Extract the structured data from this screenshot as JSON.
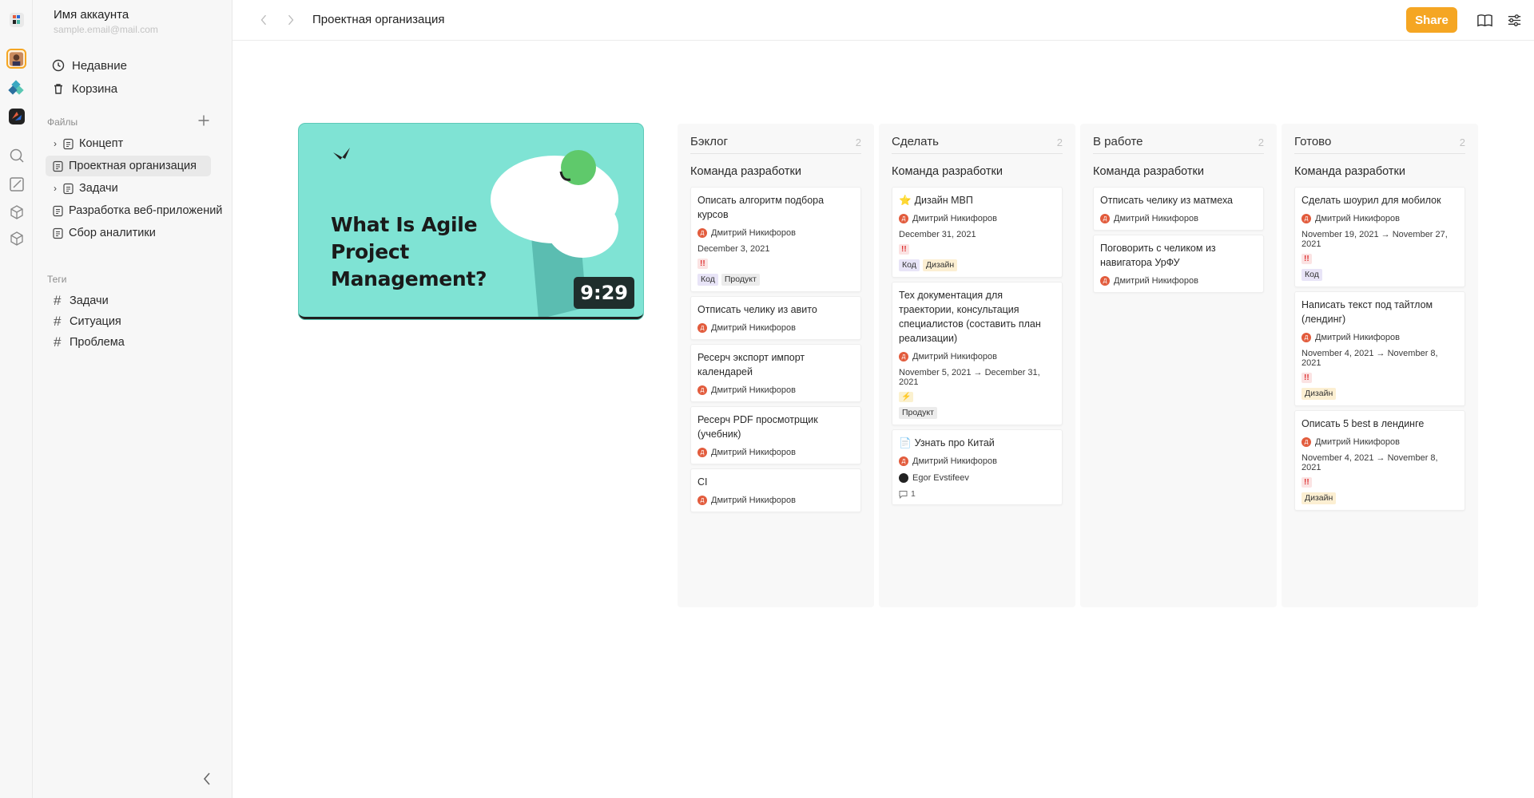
{
  "account": {
    "name": "Имя аккаунта",
    "email": "sample.email@mail.com"
  },
  "sidebar": {
    "recent": "Недавние",
    "trash": "Корзина",
    "files_label": "Файлы",
    "files": [
      {
        "label": "Концепт",
        "expandable": true
      },
      {
        "label": "Проектная организация",
        "expandable": false,
        "active": true
      },
      {
        "label": "Задачи",
        "expandable": true
      },
      {
        "label": "Разработка веб-приложений",
        "expandable": false
      },
      {
        "label": "Сбор аналитики",
        "expandable": false
      }
    ],
    "tags_label": "Теги",
    "tags": [
      "Задачи",
      "Ситуация",
      "Проблема"
    ]
  },
  "topbar": {
    "title": "Проектная организация",
    "share": "Share"
  },
  "video": {
    "title": "What Is Agile Project Management?",
    "duration": "9:29"
  },
  "board": {
    "columns": [
      {
        "title": "Бэклог",
        "count": "2",
        "group": "Команда разработки",
        "cards": [
          {
            "title": "Описать алгоритм подбора курсов",
            "author": "Дмитрий Никифоров",
            "date": "December 3, 2021",
            "prio": "!!",
            "tags": [
              {
                "label": "Код",
                "kind": "code"
              },
              {
                "label": "Продукт",
                "kind": "product"
              }
            ]
          },
          {
            "title": "Отписать челику из авито",
            "author": "Дмитрий Никифоров"
          },
          {
            "title": "Ресерч экспорт импорт календарей",
            "author": "Дмитрий Никифоров"
          },
          {
            "title": "Ресерч PDF просмотрщик (учебник)",
            "author": "Дмитрий Никифоров"
          },
          {
            "title": "CI",
            "author": "Дмитрий Никифоров"
          }
        ]
      },
      {
        "title": "Сделать",
        "count": "2",
        "group": "Команда разработки",
        "cards": [
          {
            "title": "Дизайн МВП",
            "icon": "⭐",
            "author": "Дмитрий Никифоров",
            "date": "December 31, 2021",
            "prio": "!!",
            "tags": [
              {
                "label": "Код",
                "kind": "code"
              },
              {
                "label": "Дизайн",
                "kind": "design"
              }
            ]
          },
          {
            "title": "Тех документация для траектории, консультация специалистов (составить план реализации)",
            "author": "Дмитрий Никифоров",
            "date": "November 5, 2021 → December 31, 2021",
            "prio": "⚡",
            "prio_kind": "bolt",
            "tags": [
              {
                "label": "Продукт",
                "kind": "product"
              }
            ]
          },
          {
            "title": "Узнать про Китай",
            "icon": "📄",
            "author": "Дмитрий Никифоров",
            "author2": "Egor Evstifeev",
            "comments": "1"
          }
        ]
      },
      {
        "title": "В работе",
        "count": "2",
        "group": "Команда разработки",
        "cards": [
          {
            "title": "Отписать челику из матмеха",
            "author": "Дмитрий Никифоров"
          },
          {
            "title": "Поговорить с челиком из навигатора УрФУ",
            "author": "Дмитрий Никифоров"
          }
        ]
      },
      {
        "title": "Готово",
        "count": "2",
        "group": "Команда разработки",
        "cards": [
          {
            "title": "Сделать шоурил для мобилок",
            "author": "Дмитрий Никифоров",
            "date": "November 19, 2021 → November 27, 2021",
            "prio": "!!",
            "tags": [
              {
                "label": "Код",
                "kind": "code"
              }
            ]
          },
          {
            "title": "Написать текст под тайтлом (лендинг)",
            "author": "Дмитрий Никифоров",
            "date": "November 4, 2021 → November 8, 2021",
            "prio": "!!",
            "tags": [
              {
                "label": "Дизайн",
                "kind": "design"
              }
            ]
          },
          {
            "title": "Описать 5 best в лендинге",
            "author": "Дмитрий Никифоров",
            "date": "November 4, 2021 → November 8, 2021",
            "prio": "!!",
            "tags": [
              {
                "label": "Дизайн",
                "kind": "design"
              }
            ]
          }
        ]
      }
    ]
  },
  "colors": {
    "accent": "#f5a623",
    "avatar": "#e25c3d",
    "video_bg": "#7fe3d4"
  }
}
